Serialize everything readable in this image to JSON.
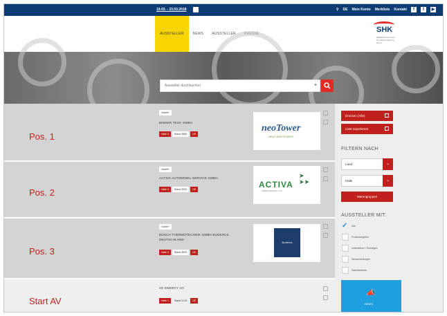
{
  "topbar": {
    "dates": "19.03. - 23.03.2018",
    "search_label": "DE",
    "lang": "Mein Konto",
    "link1": "Merkliste",
    "link2": "Kontakt",
    "social": [
      "f",
      "t",
      "▶"
    ]
  },
  "nav": {
    "items": [
      "AUSSTELLER",
      "NEWS",
      "AUSSTELLER",
      "PRESSE"
    ]
  },
  "logo": {
    "name": "SHK",
    "sub": "ESSEN Fachmesse für Sanitär Heizung Klima"
  },
  "search": {
    "placeholder": "Aussteller durchsuchen",
    "clear": "×"
  },
  "rows": [
    {
      "pos": "Pos. 1",
      "badge": "Vorteil+",
      "company": "BINDER TECK GMBH",
      "hall": "Halle 3",
      "stand": "Stand 3E80",
      "flag": "DE",
      "logo_text": "neoTower",
      "logo_sub": "HEAT AND POWER"
    },
    {
      "pos": "Pos. 2",
      "badge": "Vorteil+",
      "company": "ACTIVA AUTOMOBIL-SERVICE GMBH",
      "hall": "Halle 3",
      "stand": "Stand 3D21",
      "flag": "DE",
      "logo_text": "ACTIVA",
      "logo_sub": "GREEN ENERGY INC"
    },
    {
      "pos": "Pos. 3",
      "badge": "Vorteil+",
      "company": "BOSCH THERMOTECHNIK GMBH BUDERUS DEUTSCHLAND",
      "hall": "Halle 3",
      "stand": "Stand 3E09",
      "flag": "DE",
      "logo_text": "Buderus",
      "logo_sub": ""
    },
    {
      "pos": "Start AV",
      "badge": "",
      "company": "2G ENERGY AG",
      "hall": "Halle 1",
      "stand": "Stand 1C16",
      "flag": "DE",
      "logo_text": "",
      "logo_sub": ""
    }
  ],
  "sidebar": {
    "print_all": "Drucken (Alle)",
    "export": "Liste exportieren",
    "filter_head": "FILTERN NACH",
    "land": "Land",
    "halle": "Halle",
    "warengruppen": "Warengruppen",
    "aussteller_head": "AUSSTELLER MIT:",
    "checks": [
      "Alle",
      "Produktangebot",
      "Unterstützer / Sonstiges",
      "Neuvorstellungen",
      "Standaktionen"
    ],
    "news": "NEWS"
  },
  "colors": {
    "red": "#c0211d",
    "navy": "#0d3b73",
    "yellow": "#f6d500",
    "blue": "#1f9fe0"
  }
}
